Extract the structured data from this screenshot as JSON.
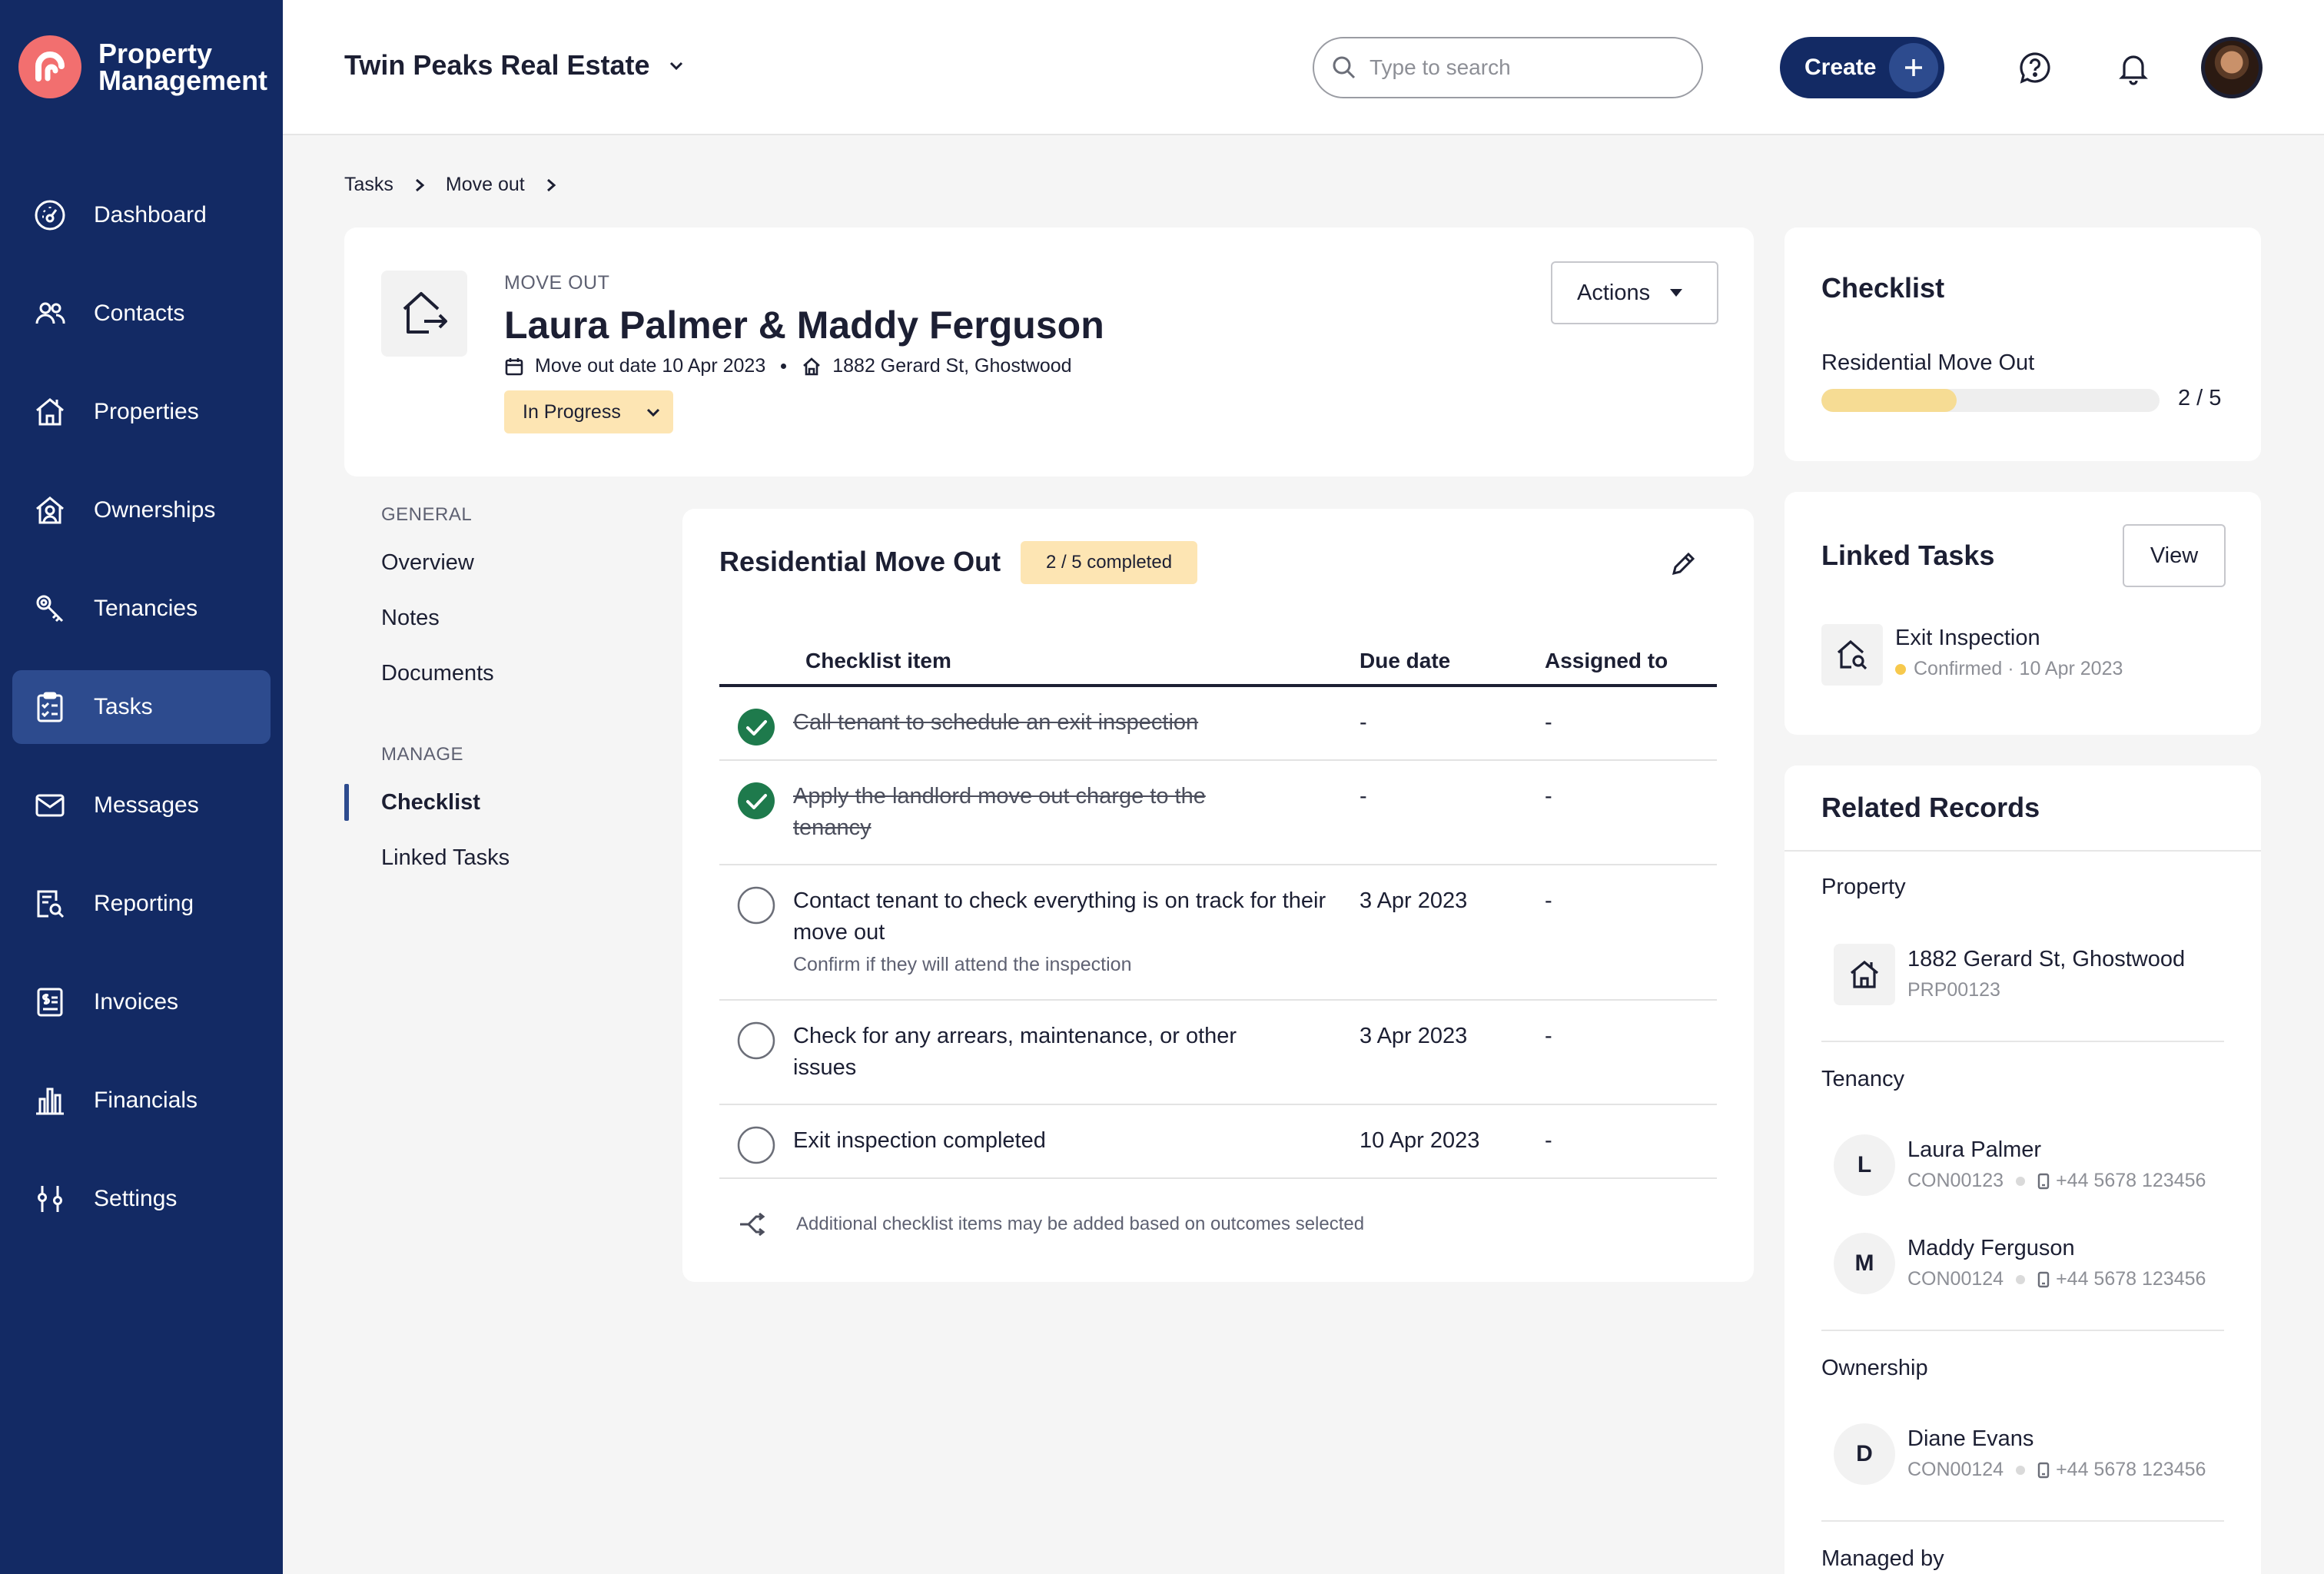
{
  "app": {
    "name": "Property Management"
  },
  "sidebar": {
    "items": [
      {
        "label": "Dashboard",
        "icon": "dashboard-icon"
      },
      {
        "label": "Contacts",
        "icon": "contacts-icon"
      },
      {
        "label": "Properties",
        "icon": "properties-icon"
      },
      {
        "label": "Ownerships",
        "icon": "ownerships-icon"
      },
      {
        "label": "Tenancies",
        "icon": "tenancies-icon"
      },
      {
        "label": "Tasks",
        "icon": "tasks-icon",
        "active": true
      },
      {
        "label": "Messages",
        "icon": "messages-icon"
      },
      {
        "label": "Reporting",
        "icon": "reporting-icon"
      },
      {
        "label": "Invoices",
        "icon": "invoices-icon"
      },
      {
        "label": "Financials",
        "icon": "financials-icon"
      },
      {
        "label": "Settings",
        "icon": "settings-icon"
      }
    ]
  },
  "header": {
    "org": "Twin Peaks Real Estate",
    "search_placeholder": "Type to search",
    "create_label": "Create"
  },
  "breadcrumb": {
    "items": [
      "Tasks",
      "Move out"
    ]
  },
  "task": {
    "kicker": "MOVE OUT",
    "title": "Laura Palmer & Maddy Ferguson",
    "move_out_date": "Move out date 10 Apr 2023",
    "address": "1882 Gerard St, Ghostwood",
    "status": "In Progress",
    "actions_label": "Actions"
  },
  "subnav": {
    "general_heading": "GENERAL",
    "general": [
      "Overview",
      "Notes",
      "Documents"
    ],
    "manage_heading": "MANAGE",
    "manage": [
      "Checklist",
      "Linked Tasks"
    ]
  },
  "checklist": {
    "title": "Residential Move Out",
    "badge": "2 / 5 completed",
    "columns": [
      "Checklist item",
      "Due date",
      "Assigned to"
    ],
    "rows": [
      {
        "item": "Call tenant to schedule an exit inspection",
        "sub": "",
        "due": "-",
        "assigned": "-",
        "done": true
      },
      {
        "item": "Apply the landlord move out charge to the tenancy",
        "sub": "",
        "due": "-",
        "assigned": "-",
        "done": true
      },
      {
        "item": "Contact tenant to check everything is on track for their move out",
        "sub": "Confirm if they will attend the inspection",
        "due": "3 Apr 2023",
        "assigned": "-",
        "done": false
      },
      {
        "item": "Check for any arrears, maintenance, or other issues",
        "sub": "",
        "due": "3 Apr 2023",
        "assigned": "-",
        "done": false
      },
      {
        "item": "Exit inspection completed",
        "sub": "",
        "due": "10 Apr 2023",
        "assigned": "-",
        "done": false
      }
    ],
    "note": "Additional checklist items may be added based on outcomes selected"
  },
  "checklist_summary": {
    "title": "Checklist",
    "label": "Residential Move Out",
    "value": "2 / 5",
    "progress": 0.4
  },
  "linked_tasks": {
    "title": "Linked Tasks",
    "view_label": "View",
    "item_name": "Exit Inspection",
    "item_meta": "Confirmed · 10 Apr 2023"
  },
  "related": {
    "title": "Related Records",
    "property_heading": "Property",
    "property": {
      "name": "1882 Gerard St, Ghostwood",
      "ref": "PRP00123"
    },
    "tenancy_heading": "Tenancy",
    "tenants": [
      {
        "initial": "L",
        "name": "Laura Palmer",
        "ref": "CON00123",
        "phone": "+44 5678 123456"
      },
      {
        "initial": "M",
        "name": "Maddy Ferguson",
        "ref": "CON00124",
        "phone": "+44 5678 123456"
      }
    ],
    "ownership_heading": "Ownership",
    "owner": {
      "initial": "D",
      "name": "Diane Evans",
      "ref": "CON00124",
      "phone": "+44 5678 123456"
    },
    "managed_heading": "Managed by"
  },
  "colors": {
    "sidebar": "#132a64",
    "active": "#2d4b8e",
    "accent_yellow": "#fde5b3",
    "done_green": "#1e7a4c",
    "brand_coral": "#f26f6f"
  }
}
